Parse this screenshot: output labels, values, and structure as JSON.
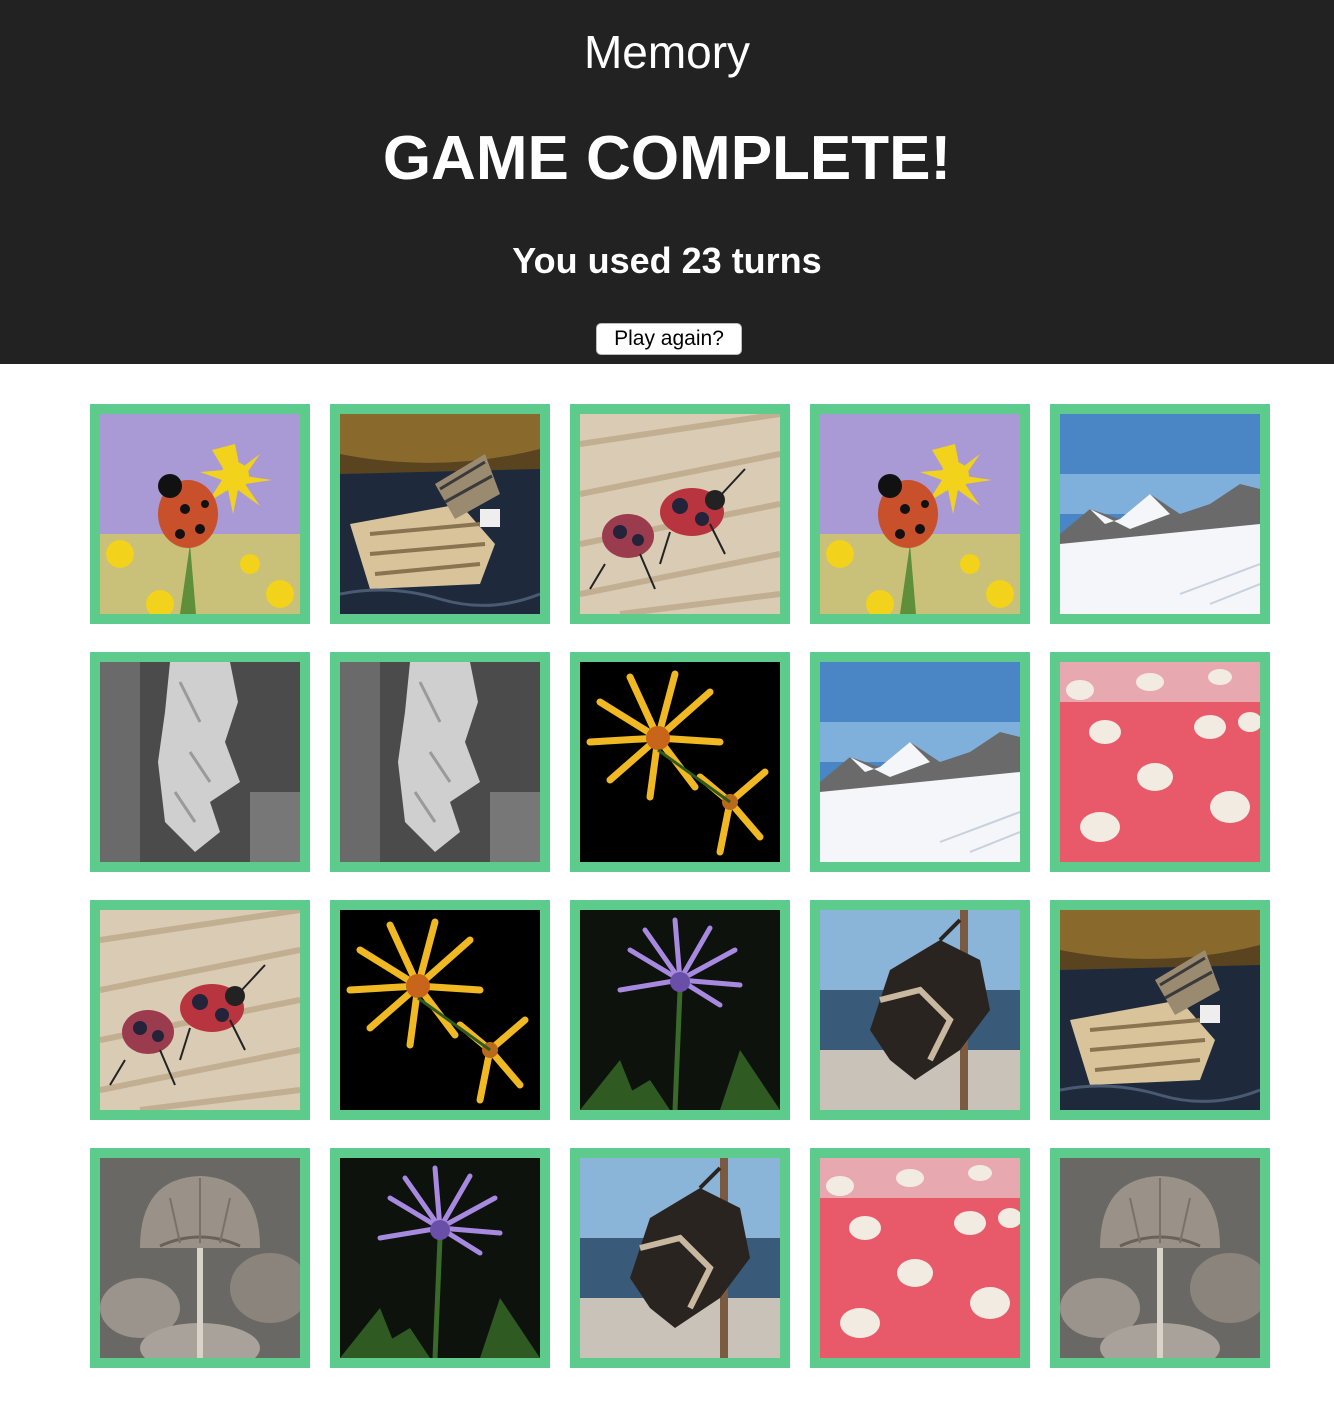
{
  "header": {
    "app_title": "Memory",
    "status_title": "GAME COMPLETE!",
    "turns_text": "You used 23 turns",
    "play_again_label": "Play again?"
  },
  "game": {
    "turns": 23,
    "complete": true,
    "matched_border_color": "#5ccb8c",
    "cards": [
      {
        "image": "ladybug-on-yellow-flower",
        "matched": true
      },
      {
        "image": "wooden-boat-wreck",
        "matched": true
      },
      {
        "image": "two-beetles-on-wood",
        "matched": true
      },
      {
        "image": "ladybug-on-yellow-flower",
        "matched": true
      },
      {
        "image": "snowy-mountains",
        "matched": true
      },
      {
        "image": "icicle",
        "matched": true
      },
      {
        "image": "icicle",
        "matched": true
      },
      {
        "image": "yellow-daisy-on-black",
        "matched": true
      },
      {
        "image": "snowy-mountains",
        "matched": true
      },
      {
        "image": "pink-meringue-dots",
        "matched": true
      },
      {
        "image": "two-beetles-on-wood",
        "matched": true
      },
      {
        "image": "yellow-daisy-on-black",
        "matched": true
      },
      {
        "image": "purple-cornflower",
        "matched": true
      },
      {
        "image": "dried-leaf-on-stem",
        "matched": true
      },
      {
        "image": "wooden-boat-wreck",
        "matched": true
      },
      {
        "image": "grey-mushroom",
        "matched": true
      },
      {
        "image": "purple-cornflower",
        "matched": true
      },
      {
        "image": "dried-leaf-on-stem",
        "matched": true
      },
      {
        "image": "pink-meringue-dots",
        "matched": true
      },
      {
        "image": "grey-mushroom",
        "matched": true
      }
    ]
  }
}
